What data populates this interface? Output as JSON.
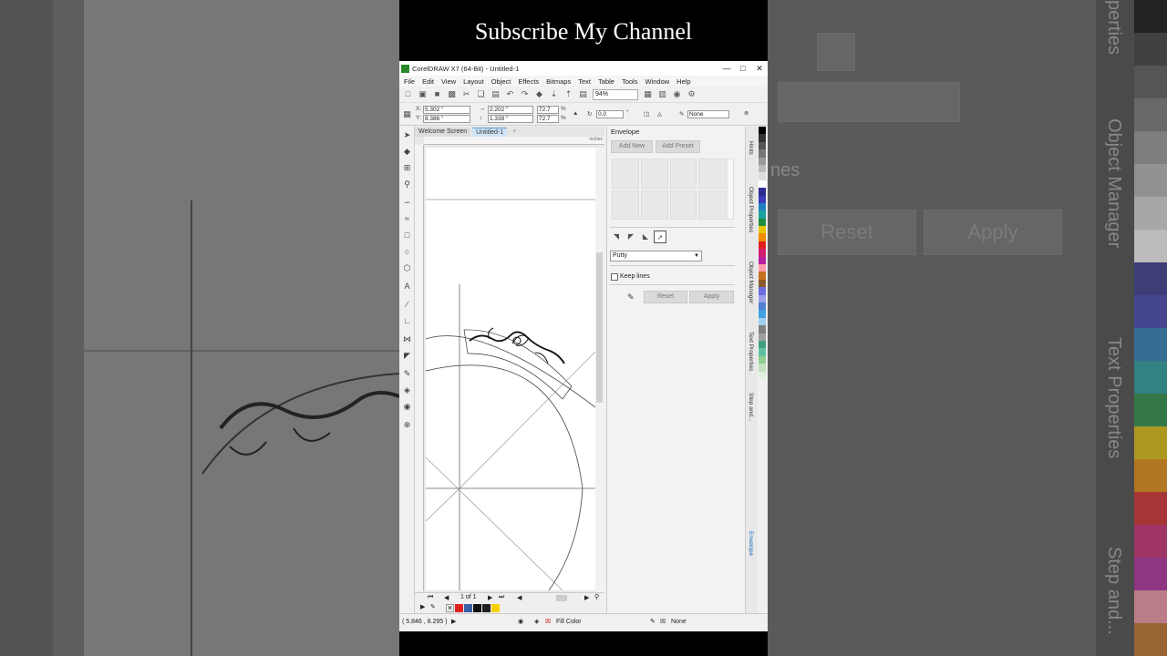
{
  "overlay": {
    "title": "Subscribe My Channel"
  },
  "window": {
    "title": "CorelDRAW X7 (64-Bit) - Untitled-1",
    "minimize": "—",
    "maximize": "□",
    "close": "✕"
  },
  "menu": [
    "File",
    "Edit",
    "View",
    "Layout",
    "Object",
    "Effects",
    "Bitmaps",
    "Text",
    "Table",
    "Tools",
    "Window",
    "Help"
  ],
  "toolbar": {
    "zoom": "94%"
  },
  "property_bar": {
    "x_label": "X:",
    "x_value": "5.302 \"",
    "y_label": "Y:",
    "y_value": "8.386 \"",
    "width_value": "2.202 \"",
    "height_value": "1.339 \"",
    "scale_w": "72.7",
    "scale_h": "72.7",
    "percent": "%",
    "rotation": "0.0",
    "degree": "°",
    "outline": "None"
  },
  "doc_tabs": [
    "Welcome Screen",
    "Untitled-1"
  ],
  "ruler": {
    "units": "inches"
  },
  "page_nav": {
    "label": "1 of 1"
  },
  "docker": {
    "title": "Envelope",
    "add_new": "Add New",
    "add_preset": "Add Preset",
    "mode": "Putty",
    "keep_lines": "Keep lines",
    "reset": "Reset",
    "apply": "Apply"
  },
  "side_tabs": [
    "Hints",
    "Object Properties",
    "Object Manager",
    "Text Properties",
    "Step and...",
    "Envelope"
  ],
  "status": {
    "coords": "( 5.846 , 8.295 )",
    "fill": "Fill Color",
    "outline": "None"
  },
  "backdrop": {
    "properties": "perties",
    "object_manager": "Object Manager",
    "text_properties": "Text Properties",
    "step_and": "Step and...",
    "lines": "nes",
    "reset": "Reset",
    "apply": "Apply"
  },
  "colors": {
    "app_bg": "#f0f0f0",
    "palette": [
      "#000000",
      "#333333",
      "#555555",
      "#777777",
      "#999999",
      "#bbbbbb",
      "#dddddd",
      "#ffffff",
      "#2d2d8f",
      "#3b3bb8",
      "#1f7fc0",
      "#1aa0a0",
      "#1f8f3f",
      "#e7c600",
      "#f08a00",
      "#e02020",
      "#d01f6f",
      "#b51f9e",
      "#ff99aa",
      "#c87020",
      "#8b5a2b",
      "#6c6ce0",
      "#9e9ee8",
      "#5080d0",
      "#40a0e0",
      "#a0d0f0",
      "#808080",
      "#a0a0a0",
      "#40a080",
      "#60c0a0",
      "#90d090",
      "#c0e0c0",
      "#e0f0e0"
    ],
    "row_swatches": [
      "#e32020",
      "#3a5fa8",
      "#111111",
      "#222222",
      "#f7d000"
    ]
  }
}
